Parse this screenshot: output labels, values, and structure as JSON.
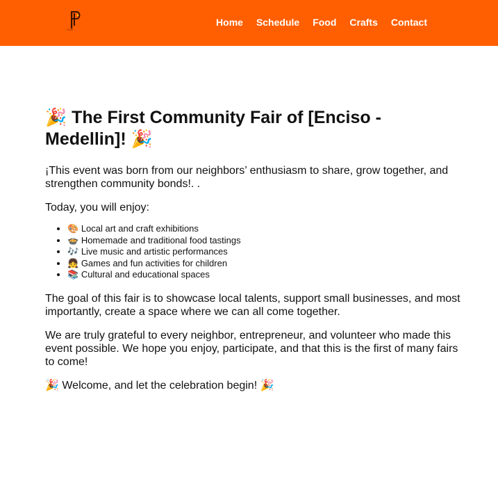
{
  "header": {
    "logo_letter": "P",
    "logo_caption": "Feria",
    "nav": [
      {
        "label": "Home"
      },
      {
        "label": "Schedule"
      },
      {
        "label": "Food"
      },
      {
        "label": "Crafts"
      },
      {
        "label": "Contact"
      }
    ]
  },
  "main": {
    "title": "🎉 The First Community Fair of [Enciso - Medellin]! 🎉",
    "intro": "¡This event was born from our neighbors’ enthusiasm to share, grow together, and strengthen community bonds!. .",
    "enjoy_heading": "Today, you will enjoy:",
    "activities": [
      {
        "icon": "🎨",
        "text": "Local art and craft exhibitions"
      },
      {
        "icon": "🍲",
        "text": "Homemade and traditional food tastings"
      },
      {
        "icon": "🎶",
        "text": "Live music and artistic performances"
      },
      {
        "icon": "👧",
        "text": "Games and fun activities for children"
      },
      {
        "icon": "📚",
        "text": "Cultural and educational spaces"
      }
    ],
    "goal": "The goal of this fair is to showcase local talents, support small businesses, and most importantly, create a space where we can all come together.",
    "thanks": "We are truly grateful to every neighbor, entrepreneur, and volunteer who made this event possible. We hope you enjoy, participate, and that this is the first of many fairs to come!",
    "closing": "🎉 Welcome, and let the celebration begin! 🎉"
  },
  "colors": {
    "header_bg": "#ff5f00",
    "nav_text": "#ffffff",
    "body_text": "#111111"
  }
}
